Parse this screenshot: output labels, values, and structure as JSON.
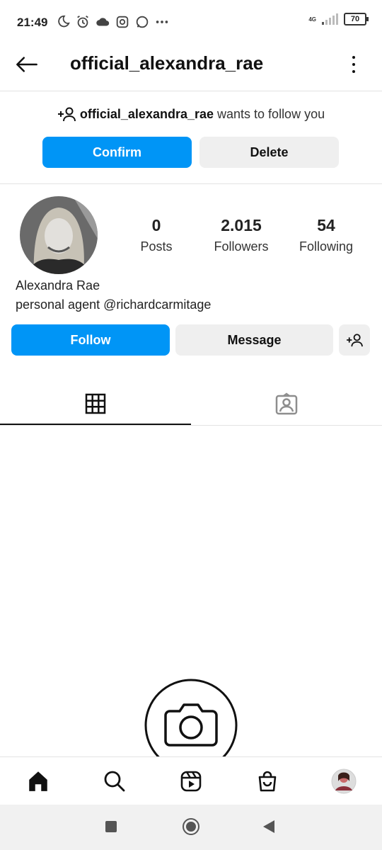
{
  "status_bar": {
    "time": "21:49",
    "network": "4G",
    "battery": "70"
  },
  "header": {
    "username": "official_alexandra_rae"
  },
  "follow_request": {
    "username": "official_alexandra_rae",
    "text": " wants to follow you",
    "confirm_label": "Confirm",
    "delete_label": "Delete"
  },
  "profile": {
    "stats": [
      {
        "value": "0",
        "label": "Posts"
      },
      {
        "value": "2.015",
        "label": "Followers"
      },
      {
        "value": "54",
        "label": "Following"
      }
    ],
    "name": "Alexandra Rae",
    "bio": "personal agent @richardcarmitage",
    "follow_label": "Follow",
    "message_label": "Message"
  },
  "tabs": [
    "grid-icon",
    "tagged-icon"
  ],
  "bottom_nav": [
    "home-icon",
    "search-icon",
    "reels-icon",
    "shop-icon",
    "profile-avatar"
  ],
  "colors": {
    "accent": "#0095f6",
    "secondary_button": "#efefef"
  }
}
